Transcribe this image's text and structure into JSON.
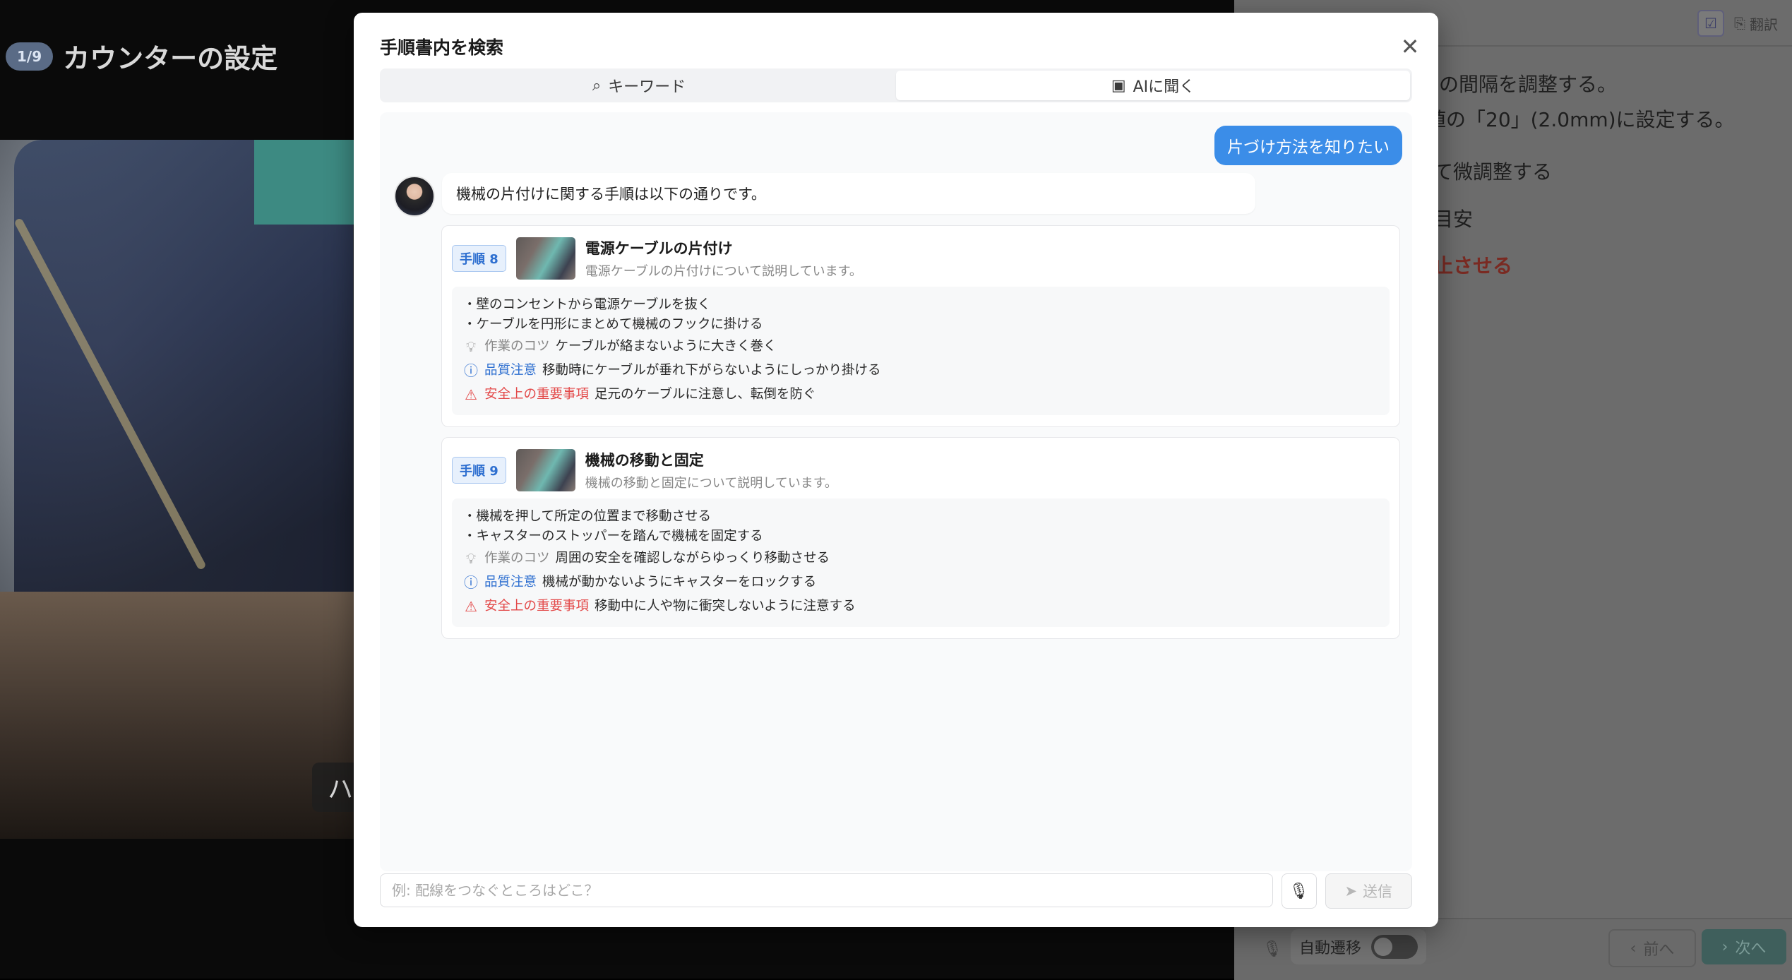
{
  "background": {
    "step": {
      "badge": "1/9",
      "title": "カウンターの設定"
    },
    "video_caption": "ハ",
    "right_panel": {
      "toolbar": {
        "check_icon": "checkbox-icon",
        "translate_label": "翻訳"
      },
      "lines": [
        {
          "text": "の間隔を調整する。",
          "style": "normal"
        },
        {
          "text": "値の「20」(2.0mm)に設定する。",
          "style": "normal"
        },
        {
          "text": "て微調整する",
          "style": "normal"
        },
        {
          "text": "目安",
          "style": "normal"
        },
        {
          "text": "止させる",
          "style": "red"
        }
      ],
      "bottom": {
        "auto_label": "自動遷移",
        "prev_label": "前へ",
        "next_label": "次へ"
      }
    }
  },
  "modal": {
    "title": "手順書内を検索",
    "tabs": [
      {
        "label": "キーワード",
        "icon": "search-icon",
        "active": false
      },
      {
        "label": "AIに聞く",
        "icon": "ai-icon",
        "active": true
      }
    ],
    "user_message": "片づけ方法を知りたい",
    "ai_message": "機械の片付けに関する手順は以下の通りです。",
    "cards": [
      {
        "tag": "手順 8",
        "title": "電源ケーブルの片付け",
        "subtitle": "電源ケーブルの片付けについて説明しています。",
        "bullets": [
          "・壁のコンセントから電源ケーブルを抜く",
          "・ケーブルを円形にまとめて機械のフックに掛ける"
        ],
        "tip_label": "作業のコツ",
        "tip_text": "ケーブルが絡まないように大きく巻く",
        "quality_label": "品質注意",
        "quality_text": "移動時にケーブルが垂れ下がらないようにしっかり掛ける",
        "safety_label": "安全上の重要事項",
        "safety_text": "足元のケーブルに注意し、転倒を防ぐ"
      },
      {
        "tag": "手順 9",
        "title": "機械の移動と固定",
        "subtitle": "機械の移動と固定について説明しています。",
        "bullets": [
          "・機械を押して所定の位置まで移動させる",
          "・キャスターのストッパーを踏んで機械を固定する"
        ],
        "tip_label": "作業のコツ",
        "tip_text": "周囲の安全を確認しながらゆっくり移動させる",
        "quality_label": "品質注意",
        "quality_text": "機械が動かないようにキャスターをロックする",
        "safety_label": "安全上の重要事項",
        "safety_text": "移動中に人や物に衝突しないように注意する"
      }
    ],
    "input": {
      "placeholder": "例: 配線をつなぐところはどこ？",
      "value": ""
    },
    "send_label": "送信",
    "colors": {
      "accent": "#3b8de8",
      "quality": "#2e6fd0",
      "safety": "#e34949"
    }
  }
}
